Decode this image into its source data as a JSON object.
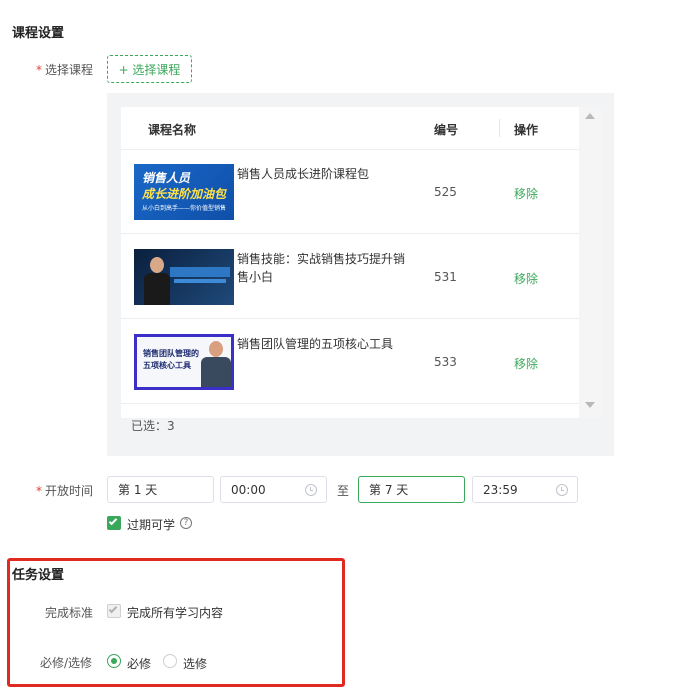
{
  "course_section": {
    "title": "课程设置",
    "select_label": "选择课程",
    "select_button": "+ 选择课程",
    "table": {
      "headers": [
        "课程名称",
        "编号",
        "操作"
      ],
      "rows": [
        {
          "name": "销售人员成长进阶课程包",
          "no": "525",
          "action": "移除",
          "thumb_text": [
            "销售人员",
            "成长进阶加油包",
            "从小白到高手——你价值型销售"
          ]
        },
        {
          "name": "销售技能：实战销售技巧提升销售小白",
          "no": "531",
          "action": "移除"
        },
        {
          "name": "销售团队管理的五项核心工具",
          "no": "533",
          "action": "移除",
          "thumb_text": [
            "销售团队管理的",
            "五项核心工具"
          ]
        }
      ]
    },
    "selected_count": "已选：3",
    "open_time": {
      "label": "开放时间",
      "start_day": "第 1 天",
      "start_time": "00:00",
      "to": "至",
      "end_day": "第 7 天",
      "end_time": "23:59"
    },
    "expired_learn": "过期可学",
    "help_glyph": "?"
  },
  "task_section": {
    "title": "任务设置",
    "completion_label": "完成标准",
    "completion_option": "完成所有学习内容",
    "type_label": "必修/选修",
    "required": "必修",
    "optional": "选修"
  },
  "colors": {
    "accent": "#3aa85a",
    "required_star": "#e0413a",
    "highlight_box": "#e02a20"
  }
}
